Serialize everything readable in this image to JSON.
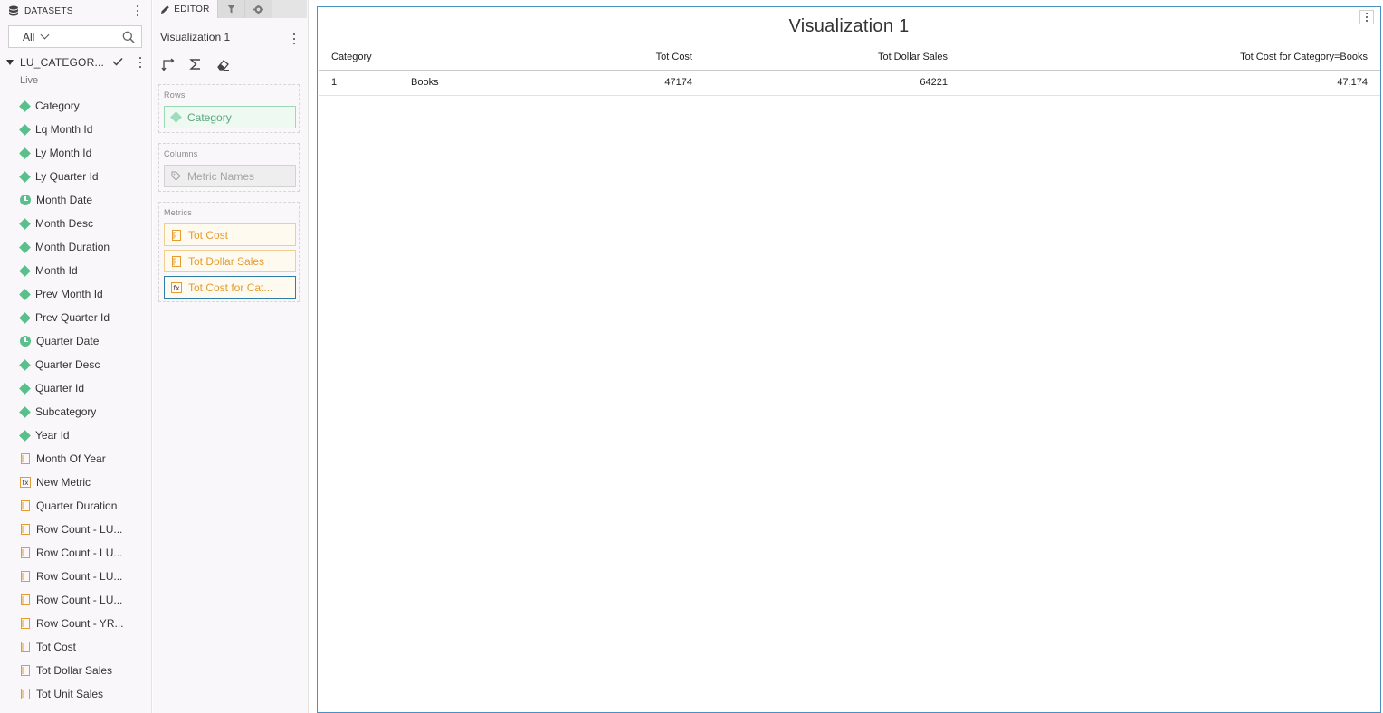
{
  "datasets": {
    "header_label": "DATASETS",
    "filter_value": "All",
    "dataset_name": "LU_CATEGOR...",
    "dataset_mode": "Live",
    "fields": [
      {
        "label": "Category",
        "icon": "attribute-diamond-icon"
      },
      {
        "label": "Lq Month Id",
        "icon": "attribute-diamond-icon"
      },
      {
        "label": "Ly Month Id",
        "icon": "attribute-diamond-icon"
      },
      {
        "label": "Ly Quarter Id",
        "icon": "attribute-diamond-icon"
      },
      {
        "label": "Month Date",
        "icon": "time-attribute-icon"
      },
      {
        "label": "Month Desc",
        "icon": "attribute-diamond-icon"
      },
      {
        "label": "Month Duration",
        "icon": "attribute-diamond-icon"
      },
      {
        "label": "Month Id",
        "icon": "attribute-diamond-icon"
      },
      {
        "label": "Prev Month Id",
        "icon": "attribute-diamond-icon"
      },
      {
        "label": "Prev Quarter Id",
        "icon": "attribute-diamond-icon"
      },
      {
        "label": "Quarter Date",
        "icon": "time-attribute-icon"
      },
      {
        "label": "Quarter Desc",
        "icon": "attribute-diamond-icon"
      },
      {
        "label": "Quarter Id",
        "icon": "attribute-diamond-icon"
      },
      {
        "label": "Subcategory",
        "icon": "attribute-diamond-icon"
      },
      {
        "label": "Year Id",
        "icon": "attribute-diamond-icon"
      },
      {
        "label": "Month Of Year",
        "icon": "metric-ruler-icon"
      },
      {
        "label": "New Metric",
        "icon": "derived-metric-fx-icon"
      },
      {
        "label": "Quarter Duration",
        "icon": "metric-ruler-icon"
      },
      {
        "label": "Row Count - LU...",
        "icon": "metric-ruler-icon"
      },
      {
        "label": "Row Count - LU...",
        "icon": "metric-ruler-icon"
      },
      {
        "label": "Row Count - LU...",
        "icon": "metric-ruler-icon"
      },
      {
        "label": "Row Count - LU...",
        "icon": "metric-ruler-icon"
      },
      {
        "label": "Row Count - YR...",
        "icon": "metric-ruler-icon"
      },
      {
        "label": "Tot Cost",
        "icon": "metric-ruler-icon"
      },
      {
        "label": "Tot Dollar Sales",
        "icon": "metric-ruler-icon"
      },
      {
        "label": "Tot Unit Sales",
        "icon": "metric-ruler-icon"
      }
    ]
  },
  "editor": {
    "tab_label": "EDITOR",
    "viz_name": "Visualization 1",
    "rows_label": "Rows",
    "columns_label": "Columns",
    "metrics_label": "Metrics",
    "rows_pill": "Category",
    "columns_pill": "Metric Names",
    "metric_pills": [
      "Tot Cost",
      "Tot Dollar Sales",
      "Tot Cost for Cat..."
    ]
  },
  "viz": {
    "title": "Visualization 1",
    "columns": [
      "Category",
      "",
      "Tot Cost",
      "Tot Dollar Sales",
      "Tot Cost for Category=Books"
    ],
    "rows": [
      [
        "1",
        "Books",
        "47174",
        "64221",
        "47,174"
      ]
    ]
  },
  "colors": {
    "attribute": "#59c08c",
    "metric": "#e29c2f",
    "selected_border": "#2e7ea8",
    "viz_border": "#4a90c2"
  }
}
